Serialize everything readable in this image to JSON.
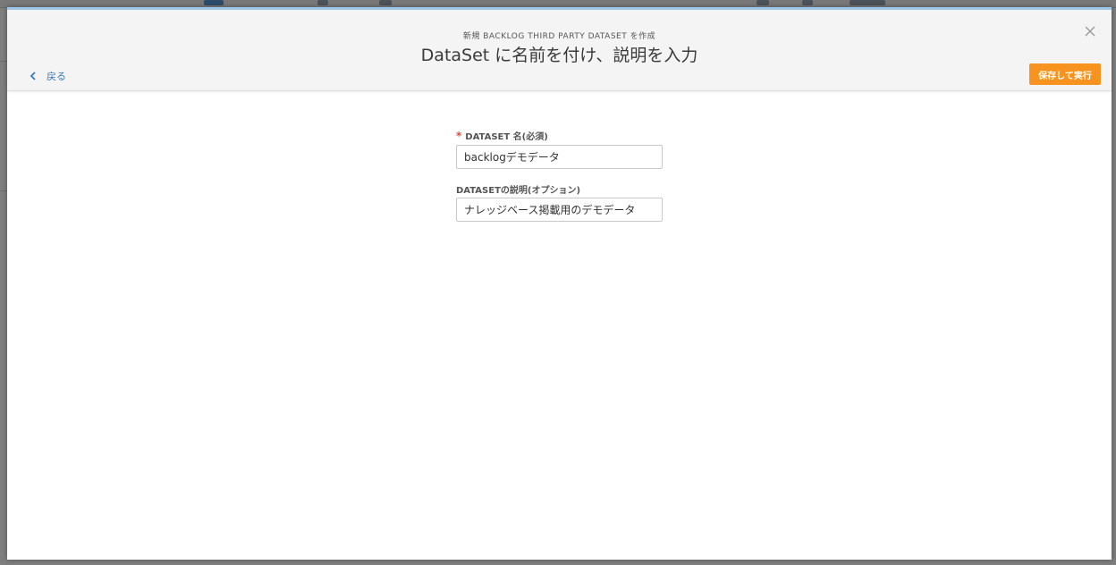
{
  "modal": {
    "subtitle": "新規 BACKLOG THIRD PARTY DATASET を作成",
    "title": "DataSet に名前を付け、説明を入力",
    "back_label": "戻る",
    "save_label": "保存して実行",
    "close_icon": "close-icon",
    "back_icon": "chevron-left-icon"
  },
  "form": {
    "name_label": "DATASET 名(必須)",
    "name_required_mark": "*",
    "name_value": "backlogデモデータ",
    "description_label": "DATASETの説明(オプション)",
    "description_value": "ナレッジベース掲載用のデモデータ"
  },
  "colors": {
    "primary_action": "#f7931e",
    "link": "#3d78b8",
    "required": "#e04a2f",
    "header_accent": "#9ec6ea"
  }
}
